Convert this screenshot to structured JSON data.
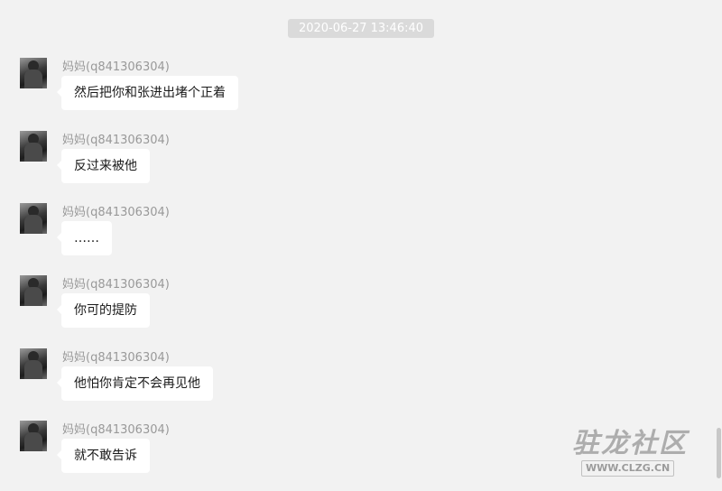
{
  "chat": {
    "timestamp": "2020-06-27 13:46:40",
    "messages": [
      {
        "sender": "妈妈(q841306304)",
        "text": "然后把你和张进出堵个正着"
      },
      {
        "sender": "妈妈(q841306304)",
        "text": "反过来被他"
      },
      {
        "sender": "妈妈(q841306304)",
        "text": "……"
      },
      {
        "sender": "妈妈(q841306304)",
        "text": "你可的提防"
      },
      {
        "sender": "妈妈(q841306304)",
        "text": "他怕你肯定不会再见他"
      },
      {
        "sender": "妈妈(q841306304)",
        "text": "就不敢告诉"
      }
    ]
  },
  "watermark": {
    "title": "驻龙社区",
    "url": "WWW.CLZG.CN"
  },
  "icons": {
    "avatar": "user-avatar-photo",
    "scrollbar": "vertical-scrollbar-thumb"
  }
}
